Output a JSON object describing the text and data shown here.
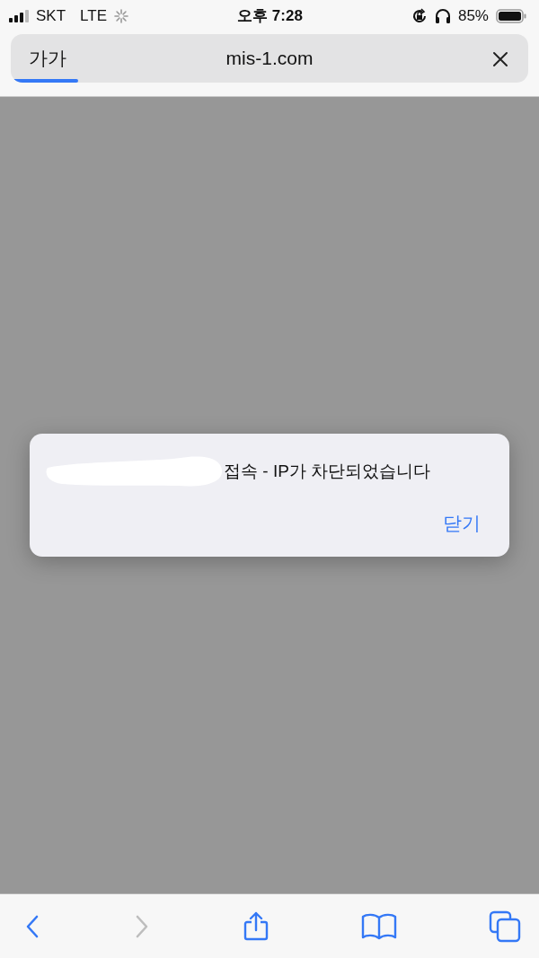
{
  "status_bar": {
    "carrier": "SKT",
    "network": "LTE",
    "time": "오후 7:28",
    "battery_percent": "85%"
  },
  "address_bar": {
    "text_size_button": "가가",
    "url": "mis-1.com",
    "loading": {
      "level": 0.13
    }
  },
  "alert": {
    "message": "접속 - IP가 차단되었습니다",
    "redacted": true,
    "button": "닫기"
  },
  "toolbar": [
    {
      "kind": "back",
      "disabled": false
    },
    {
      "kind": "forward",
      "disabled": true
    },
    {
      "kind": "share",
      "disabled": false
    },
    {
      "kind": "bookmarks",
      "disabled": false
    },
    {
      "kind": "tabs",
      "disabled": false
    }
  ]
}
